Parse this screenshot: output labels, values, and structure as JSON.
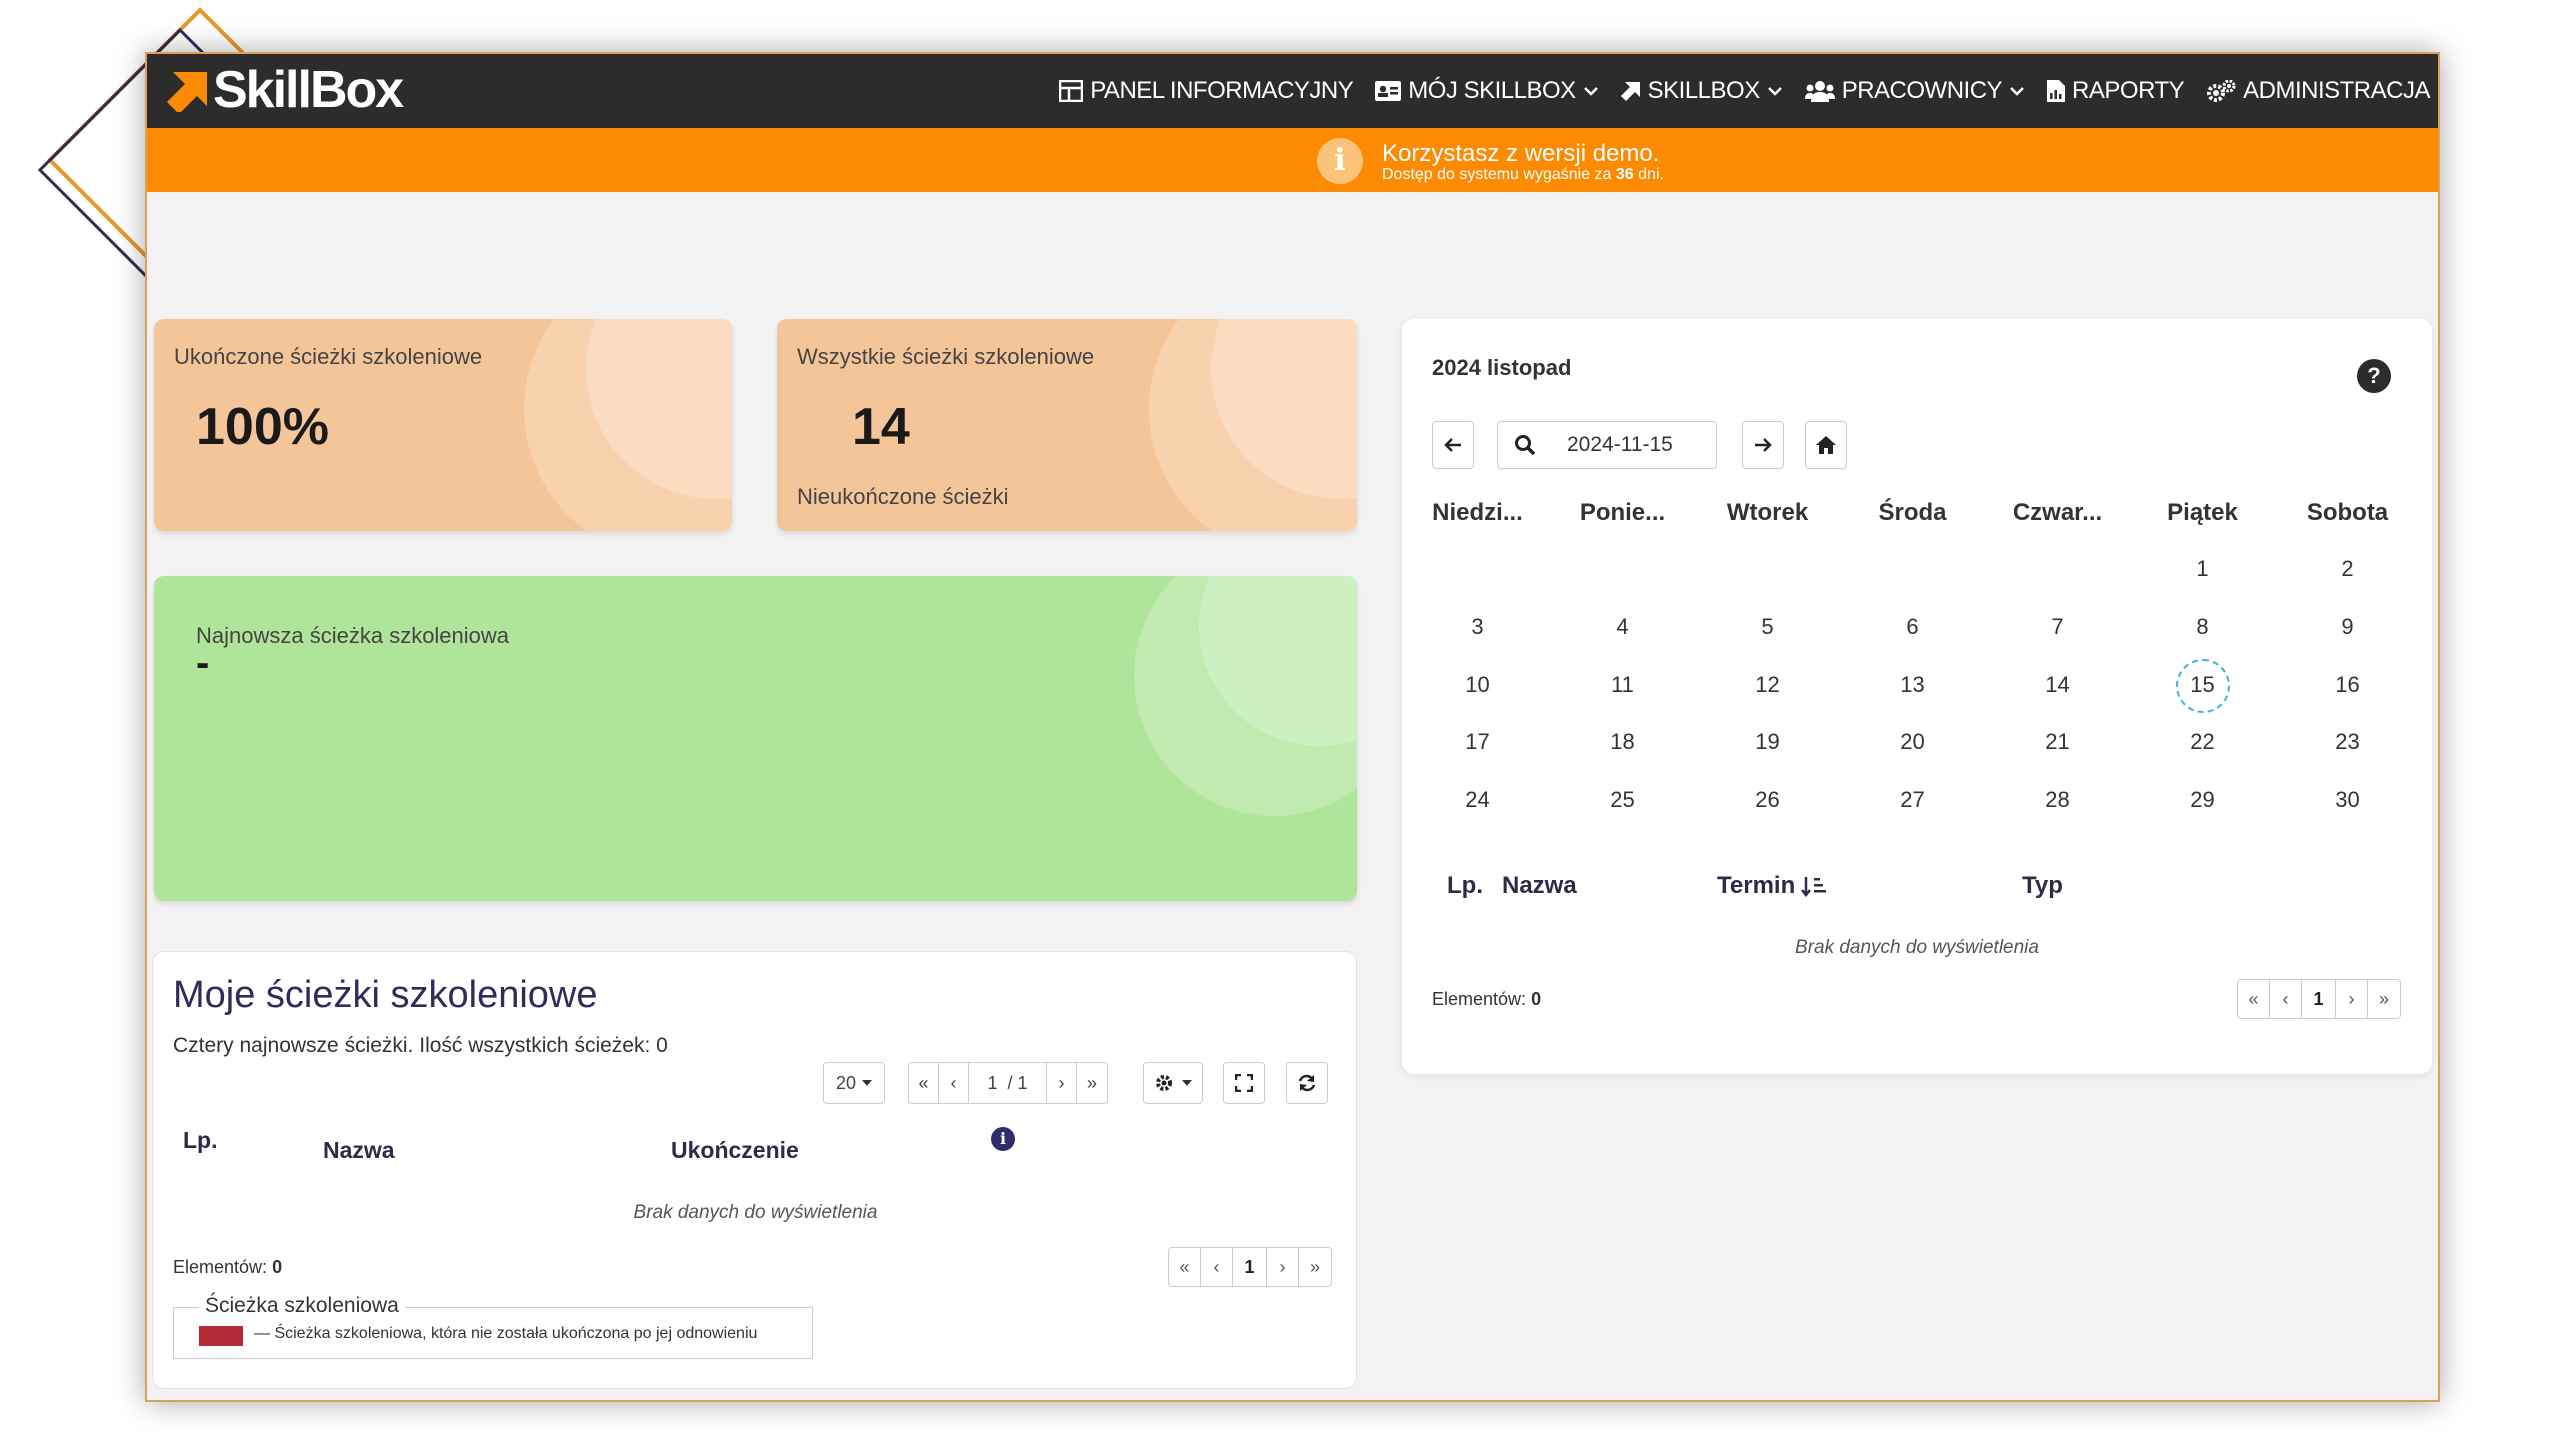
{
  "brand": {
    "name": "SkillBox",
    "accent": "#fc8b03",
    "nav_bg": "#2c2c2c"
  },
  "nav": [
    {
      "label": "PANEL INFORMACYJNY",
      "icon": "dashboard-icon",
      "dropdown": false
    },
    {
      "label": "MÓJ SKILLBOX",
      "icon": "id-card-icon",
      "dropdown": true
    },
    {
      "label": "SKILLBOX",
      "icon": "arrow-icon",
      "dropdown": true
    },
    {
      "label": "PRACOWNICY",
      "icon": "users-icon",
      "dropdown": true
    },
    {
      "label": "RAPORTY",
      "icon": "report-icon",
      "dropdown": false
    },
    {
      "label": "ADMINISTRACJA",
      "icon": "cogs-icon",
      "dropdown": false
    }
  ],
  "banner": {
    "main": "Korzystasz z wersji demo.",
    "sub_prefix": "Dostęp do systemu wygaśnie za",
    "days": "36",
    "sub_suffix": "dni."
  },
  "stats": {
    "completed_label": "Ukończone ścieżki szkoleniowe",
    "completed_value": "100%",
    "all_label": "Wszystkie ścieżki szkoleniowe",
    "all_value": "14",
    "all_sub": "Nieukończone ścieżki",
    "newest_label": "Najnowsza ścieżka szkoleniowa",
    "newest_value": "-"
  },
  "calendar": {
    "title": "2024 listopad",
    "date_value": "2024-11-15",
    "weekdays": [
      "Niedzi...",
      "Ponie...",
      "Wtorek",
      "Środa",
      "Czwar...",
      "Piątek",
      "Sobota"
    ],
    "weeks": [
      [
        "",
        "",
        "",
        "",
        "",
        "1",
        "2"
      ],
      [
        "3",
        "4",
        "5",
        "6",
        "7",
        "8",
        "9"
      ],
      [
        "10",
        "11",
        "12",
        "13",
        "14",
        "15",
        "16"
      ],
      [
        "17",
        "18",
        "19",
        "20",
        "21",
        "22",
        "23"
      ],
      [
        "24",
        "25",
        "26",
        "27",
        "28",
        "29",
        "30"
      ]
    ],
    "today": "15",
    "table_headers": {
      "lp": "Lp.",
      "name": "Nazwa",
      "term": "Termin",
      "type": "Typ"
    },
    "no_data": "Brak danych do wyświetlenia",
    "count_label": "Elementów:",
    "count_value": "0",
    "pager": {
      "first": "«",
      "prev": "‹",
      "current": "1",
      "next": "›",
      "last": "»"
    }
  },
  "paths": {
    "title": "Moje ścieżki szkoleniowe",
    "subtitle": "Cztery najnowsze ścieżki. Ilość wszystkich ścieżek: 0",
    "page_size": "20",
    "page_indicator": "1",
    "page_total": "/ 1",
    "headers": {
      "lp": "Lp.",
      "name": "Nazwa",
      "completion": "Ukończenie"
    },
    "no_data": "Brak danych do wyświetlenia",
    "count_label": "Elementów:",
    "count_value": "0",
    "pager": {
      "first": "«",
      "prev": "‹",
      "current": "1",
      "next": "›",
      "last": "»"
    },
    "legend_title": "Ścieżka szkoleniowa",
    "legend_text": "— Ścieżka szkoleniowa, która nie została ukończona po jej odnowieniu",
    "legend_color": "#b52a36"
  }
}
